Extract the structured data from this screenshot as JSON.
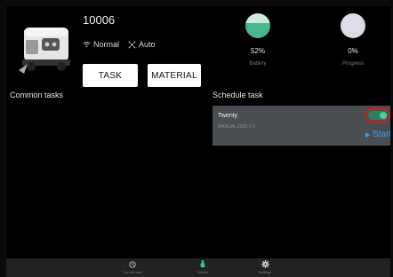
{
  "device": {
    "id": "10006",
    "connection": "Normal",
    "mode": "Auto"
  },
  "buttons": {
    "task": "TASK",
    "material": "MATERIAL"
  },
  "gauges": {
    "battery": {
      "percent": "52%",
      "label": "Battery",
      "level": 0.52,
      "color": "#46b88d"
    },
    "progress": {
      "percent": "0%",
      "label": "Progress",
      "level": 0.0,
      "color": "#dcdce6"
    }
  },
  "sections": {
    "common": "Common tasks",
    "schedule": "Schedule task"
  },
  "schedule_items": [
    {
      "name": "Twenty",
      "subtitle": "MANUAL  2022-7-7",
      "enabled": true,
      "start_label": "Start"
    }
  ],
  "nav": {
    "current_task": "Current task",
    "device": "Device",
    "settings": "Settings"
  },
  "icons": {
    "wifi": "wifi-icon",
    "auto": "auto-mode-icon",
    "current_task": "clock-icon",
    "device": "robot-icon",
    "settings": "gear-icon"
  },
  "colors": {
    "accent": "#3aa0e8",
    "toggle_on": "#45d19a",
    "highlight": "#d0201c"
  }
}
